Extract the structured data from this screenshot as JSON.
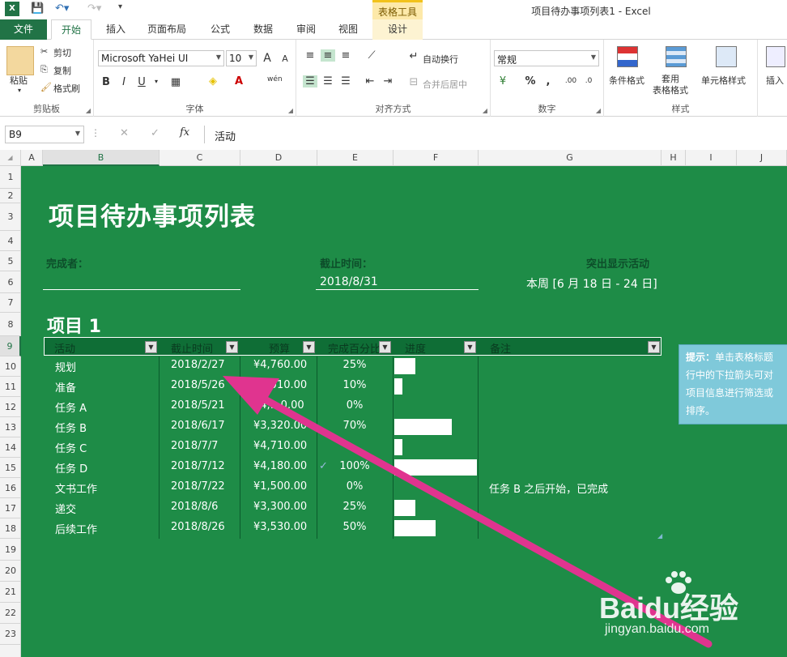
{
  "window": {
    "title": "项目待办事项列表1 - Excel",
    "context_group": "表格工具"
  },
  "tabs": [
    "文件",
    "开始",
    "插入",
    "页面布局",
    "公式",
    "数据",
    "审阅",
    "视图",
    "设计"
  ],
  "ribbon": {
    "clipboard": {
      "paste": "粘贴",
      "cut": "剪切",
      "copy": "复制",
      "format_painter": "格式刷",
      "label": "剪贴板"
    },
    "font": {
      "name": "Microsoft YaHei UI",
      "size": "10",
      "bold": "B",
      "italic": "I",
      "underline": "U",
      "label": "字体"
    },
    "alignment": {
      "wrap": "自动换行",
      "merge": "合并后居中",
      "label": "对齐方式"
    },
    "number": {
      "format": "常规",
      "label": "数字"
    },
    "styles": {
      "conditional": "条件格式",
      "as_table": "套用\n表格格式",
      "cell_styles": "单元格样式",
      "label": "样式"
    },
    "cells": {
      "insert": "插入"
    }
  },
  "formula_bar": {
    "name_box": "B9",
    "fx": "fx",
    "content": "活动"
  },
  "columns": [
    "A",
    "B",
    "C",
    "D",
    "E",
    "F",
    "G",
    "H",
    "I",
    "J"
  ],
  "rows": [
    "1",
    "2",
    "3",
    "4",
    "5",
    "6",
    "7",
    "8",
    "9",
    "10",
    "11",
    "12",
    "13",
    "14",
    "15",
    "16",
    "17",
    "18",
    "19",
    "20",
    "21",
    "22",
    "23"
  ],
  "sheet": {
    "title": "项目待办事项列表",
    "owner_label": "完成者：",
    "deadline_label": "截止时间：",
    "deadline_value": "2018/8/31",
    "highlight_label": "突出显示活动",
    "highlight_value": "本周 [6 月 18 日 - 24 日]",
    "project_title": "项目 1",
    "headers": [
      "活动",
      "截止时间",
      "预算",
      "完成百分比",
      "进度",
      "备注"
    ],
    "rows": [
      {
        "activity": "规划",
        "due": "2018/2/27",
        "budget": "¥4,760.00",
        "pct": "25%",
        "progress": 0.25,
        "note": ""
      },
      {
        "activity": "准备",
        "due": "2018/5/26",
        "budget": "¥3,010.00",
        "pct": "10%",
        "progress": 0.1,
        "note": ""
      },
      {
        "activity": "任务 A",
        "due": "2018/5/21",
        "budget": "¥4,…0.00",
        "pct": "0%",
        "progress": 0.0,
        "note": ""
      },
      {
        "activity": "任务 B",
        "due": "2018/6/17",
        "budget": "¥3,320.00",
        "pct": "70%",
        "progress": 0.7,
        "note": ""
      },
      {
        "activity": "任务 C",
        "due": "2018/7/7",
        "budget": "¥4,710.00",
        "pct": "",
        "progress": 0.1,
        "note": ""
      },
      {
        "activity": "任务 D",
        "due": "2018/7/12",
        "budget": "¥4,180.00",
        "pct": "100%",
        "progress": 1.0,
        "note": "",
        "done": true
      },
      {
        "activity": "文书工作",
        "due": "2018/7/22",
        "budget": "¥1,500.00",
        "pct": "0%",
        "progress": 0.0,
        "note": "任务 B 之后开始，已完成"
      },
      {
        "activity": "递交",
        "due": "2018/8/6",
        "budget": "¥3,300.00",
        "pct": "25%",
        "progress": 0.25,
        "note": ""
      },
      {
        "activity": "后续工作",
        "due": "2018/8/26",
        "budget": "¥3,530.00",
        "pct": "50%",
        "progress": 0.5,
        "note": ""
      }
    ],
    "tip_bold": "提示：",
    "tip_text": "单击表格标题行中的下拉箭头可对项目信息进行筛选或排序。"
  },
  "watermark": {
    "brand": "Baidu经验",
    "url": "jingyan.baidu.com"
  },
  "colors": {
    "excel_green": "#217346",
    "sheet_green": "#1e8c47",
    "arrow": "#e0348f",
    "tip_bg": "#7fc9da"
  }
}
